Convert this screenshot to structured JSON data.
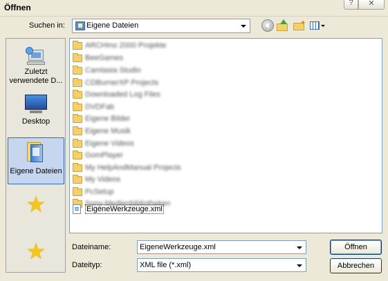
{
  "window": {
    "title": "Öffnen",
    "help_glyph": "?",
    "close_glyph": "✕"
  },
  "lookin": {
    "label": "Suchen in:",
    "value": "Eigene Dateien"
  },
  "toolbar": {
    "icons": [
      "back-icon",
      "up-folder-icon",
      "new-folder-icon",
      "view-menu-icon"
    ]
  },
  "places": [
    {
      "label": "Zuletzt verwendete D...",
      "icon": "recent-documents-icon"
    },
    {
      "label": "Desktop",
      "icon": "desktop-icon"
    },
    {
      "label": "Eigene Dateien",
      "icon": "my-documents-icon",
      "selected": true
    },
    {
      "label": "",
      "icon": "star-icon"
    },
    {
      "label": "",
      "icon": "star-icon"
    }
  ],
  "files": [
    {
      "name": "ARCHIno 2000 Projekte",
      "type": "folder"
    },
    {
      "name": "BeeGames",
      "type": "folder"
    },
    {
      "name": "Camtasia Studio",
      "type": "folder"
    },
    {
      "name": "CDBurnerXP Projects",
      "type": "folder"
    },
    {
      "name": "Downloaded Log Files",
      "type": "folder"
    },
    {
      "name": "DVDFab",
      "type": "folder"
    },
    {
      "name": "Eigene Bilder",
      "type": "folder"
    },
    {
      "name": "Eigene Musik",
      "type": "folder"
    },
    {
      "name": "Eigene Videos",
      "type": "folder"
    },
    {
      "name": "GomPlayer",
      "type": "folder"
    },
    {
      "name": "My HelpAndManual Projects",
      "type": "folder"
    },
    {
      "name": "My Videos",
      "type": "folder"
    },
    {
      "name": "PcSetup",
      "type": "folder"
    },
    {
      "name": "Sony-Medienbibliotheken",
      "type": "folder"
    },
    {
      "name": "EigeneWerkzeuge.xml",
      "type": "xml",
      "selected": true
    }
  ],
  "filename": {
    "label": "Dateiname:",
    "value": "EigeneWerkzeuge.xml"
  },
  "filetype": {
    "label": "Dateityp:",
    "value": "XML file (*.xml)"
  },
  "buttons": {
    "open": "Öffnen",
    "cancel": "Abbrechen"
  },
  "colors": {
    "dialog_bg": "#ece9d8",
    "selection": "#c5d6ee",
    "folder": "#f3d06a"
  }
}
